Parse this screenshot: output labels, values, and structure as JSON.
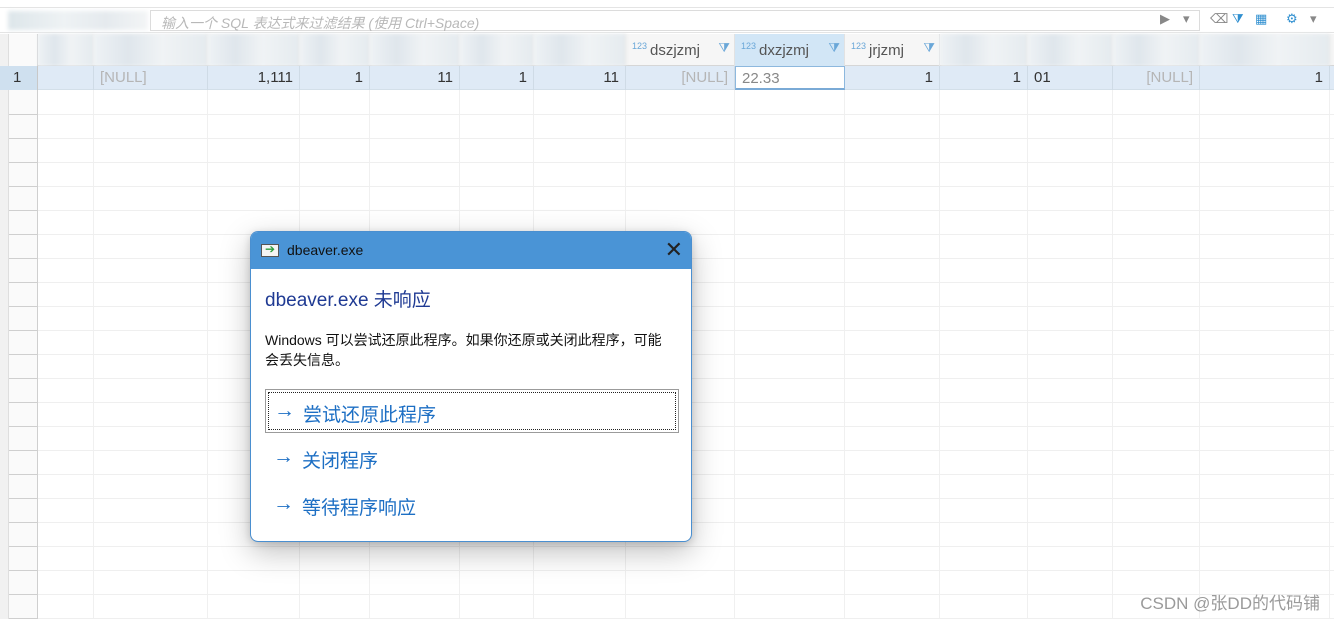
{
  "filter": {
    "placeholder": "输入一个 SQL 表达式来过滤结果 (使用 Ctrl+Space)",
    "toolbar_icons": [
      "play-icon",
      "dropdown-icon",
      "eraser-icon",
      "filter-icon",
      "grid-config-icon",
      "settings-icon",
      "chevron-down-icon"
    ]
  },
  "columns": [
    {
      "name": "",
      "type": ""
    },
    {
      "name": "",
      "type": ""
    },
    {
      "name": "",
      "type": ""
    },
    {
      "name": "",
      "type": ""
    },
    {
      "name": "",
      "type": ""
    },
    {
      "name": "",
      "type": ""
    },
    {
      "name": "",
      "type": ""
    },
    {
      "name": "dszjzmj",
      "type": "123"
    },
    {
      "name": "dxzjzmj",
      "type": "123"
    },
    {
      "name": "jrjzmj",
      "type": "123"
    },
    {
      "name": "",
      "type": ""
    },
    {
      "name": "",
      "type": ""
    },
    {
      "name": "",
      "type": ""
    },
    {
      "name": "",
      "type": ""
    }
  ],
  "rows": [
    {
      "row_number": "1",
      "cells": [
        "",
        "[NULL]",
        "1,111",
        "1",
        "11",
        "1",
        "11",
        "[NULL]",
        "22.33",
        "1",
        "1",
        "01",
        "[NULL]",
        "1"
      ]
    }
  ],
  "dialog": {
    "title": "dbeaver.exe",
    "heading": "dbeaver.exe 未响应",
    "message": "Windows 可以尝试还原此程序。如果你还原或关闭此程序，可能会丢失信息。",
    "options": [
      {
        "label": "尝试还原此程序"
      },
      {
        "label": "关闭程序"
      },
      {
        "label": "等待程序响应"
      }
    ],
    "close_symbol": "✕",
    "accent_color": "#4a94d6",
    "link_color": "#1d6fc4"
  },
  "watermark": "CSDN @张DD的代码铺"
}
